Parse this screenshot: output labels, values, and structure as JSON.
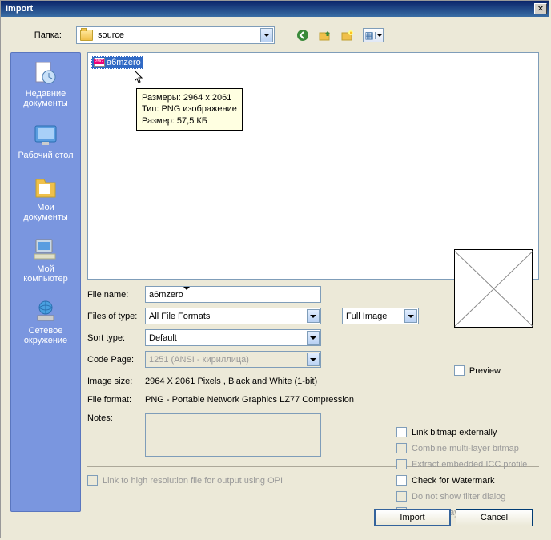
{
  "window": {
    "title": "Import"
  },
  "toprow": {
    "label": "Папка:",
    "folder": "source"
  },
  "tooltip": {
    "line1": "Размеры: 2964 x 2061",
    "line2": "Тип: PNG изображение",
    "line3": "Размер: 57,5 КБ"
  },
  "sidebar": {
    "items": [
      {
        "label": "Недавние документы"
      },
      {
        "label": "Рабочий стол"
      },
      {
        "label": "Мои документы"
      },
      {
        "label": "Мой компьютер"
      },
      {
        "label": "Сетевое окружение"
      }
    ]
  },
  "file": {
    "name": "a6mzero"
  },
  "labels": {
    "filename": "File name:",
    "filetype": "Files of type:",
    "sorttype": "Sort type:",
    "codepage": "Code Page:",
    "imagesize": "Image size:",
    "fileformat": "File format:",
    "notes": "Notes:",
    "preview": "Preview",
    "fullimage": "Full Image",
    "allformats": "All File Formats",
    "default": "Default",
    "codepageval": "1251  (ANSI - кириллица)",
    "imgsizeval": "2964 X 2061 Pixels , Black and White (1-bit)",
    "ffval": "PNG - Portable Network Graphics LZ77 Compression"
  },
  "checks": {
    "linkext": "Link bitmap externally",
    "combine": "Combine multi-layer bitmap",
    "extracticc": "Extract embedded ICC profile",
    "watermark": "Check for Watermark",
    "nofilter": "Do not show filter dialog",
    "maintain": "Maintain layers and pages",
    "opi": "Link to high resolution file for output using OPI"
  },
  "buttons": {
    "import": "Import",
    "cancel": "Cancel"
  }
}
